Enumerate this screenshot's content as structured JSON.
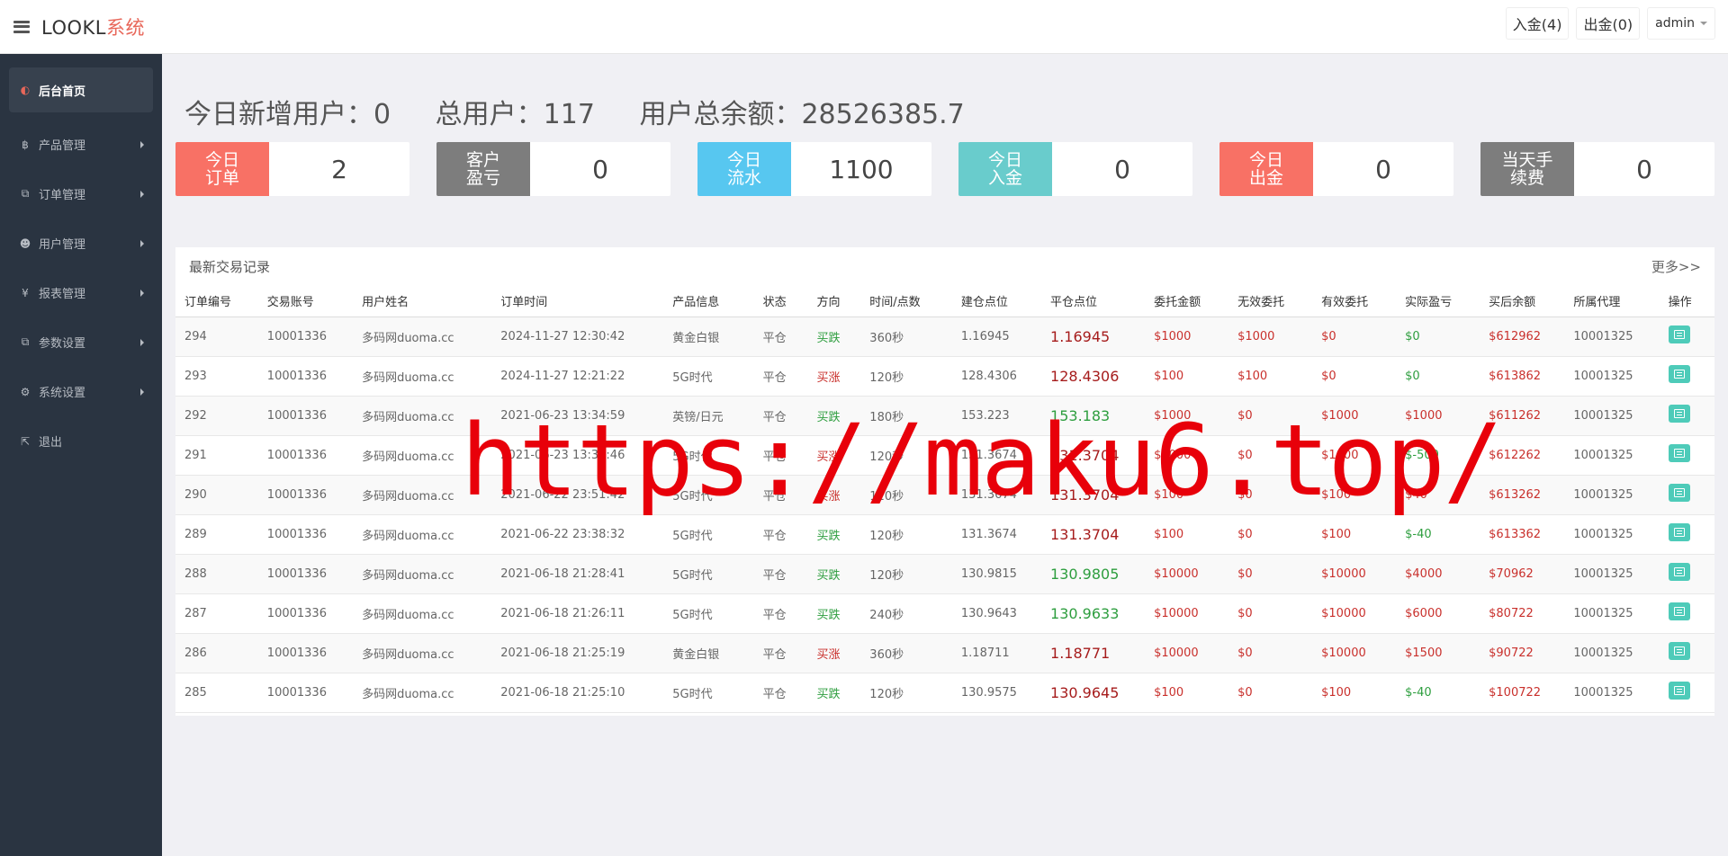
{
  "header": {
    "brand_main": "LOOKL",
    "brand_accent": "系统",
    "deposit_label": "入金(4)",
    "withdraw_label": "出金(0)",
    "admin_label": "admin"
  },
  "sidebar": {
    "items": [
      {
        "label": "后台首页",
        "icon": "dashboard-icon"
      },
      {
        "label": "产品管理",
        "icon": "bitcoin-icon"
      },
      {
        "label": "订单管理",
        "icon": "copy-icon"
      },
      {
        "label": "用户管理",
        "icon": "user-icon"
      },
      {
        "label": "报表管理",
        "icon": "yen-icon"
      },
      {
        "label": "参数设置",
        "icon": "copy-icon"
      },
      {
        "label": "系统设置",
        "icon": "gears-icon"
      },
      {
        "label": "退出",
        "icon": "sign-out-icon"
      }
    ]
  },
  "stats": {
    "new_users": "今日新增用户：0",
    "total_users": "总用户：117",
    "total_balance": "用户总余额：28526385.7"
  },
  "cards": [
    {
      "label": "今日订单",
      "value": "2",
      "color": "#f87165"
    },
    {
      "label": "客户盈亏",
      "value": "0",
      "color": "#7d7d7d"
    },
    {
      "label": "今日流水",
      "value": "1100",
      "color": "#57c7f0"
    },
    {
      "label": "今日入金",
      "value": "0",
      "color": "#69cccc"
    },
    {
      "label": "今日出金",
      "value": "0",
      "color": "#f87165"
    },
    {
      "label": "当天手续费",
      "value": "0",
      "color": "#7d7d7d"
    }
  ],
  "panel": {
    "title": "最新交易记录",
    "more": "更多>>"
  },
  "table": {
    "columns": [
      "订单编号",
      "交易账号",
      "用户姓名",
      "订单时间",
      "产品信息",
      "状态",
      "方向",
      "时间/点数",
      "建仓点位",
      "平仓点位",
      "委托金额",
      "无效委托",
      "有效委托",
      "实际盈亏",
      "买后余额",
      "所属代理",
      "操作"
    ],
    "rows": [
      [
        "294",
        "10001336",
        "多码网duoma.cc",
        "2024-11-27 12:30:42",
        "黄金白银",
        "平仓",
        "买跌",
        "360秒",
        "1.16945",
        "1.16945",
        "$1000",
        "$1000",
        "$0",
        "$0",
        "$612962",
        "10001325"
      ],
      [
        "293",
        "10001336",
        "多码网duoma.cc",
        "2024-11-27 12:21:22",
        "5G时代",
        "平仓",
        "买涨",
        "120秒",
        "128.4306",
        "128.4306",
        "$100",
        "$100",
        "$0",
        "$0",
        "$613862",
        "10001325"
      ],
      [
        "292",
        "10001336",
        "多码网duoma.cc",
        "2021-06-23 13:34:59",
        "英镑/日元",
        "平仓",
        "买跌",
        "180秒",
        "153.223",
        "153.183",
        "$1000",
        "$0",
        "$1000",
        "$1000",
        "$611262",
        "10001325"
      ],
      [
        "291",
        "10001336",
        "多码网duoma.cc",
        "2021-06-23 13:33:46",
        "5G时代",
        "平仓",
        "买涨",
        "120秒",
        "131.3674",
        "131.3704",
        "$1000",
        "$0",
        "$1000",
        "$-500",
        "$612262",
        "10001325"
      ],
      [
        "290",
        "10001336",
        "多码网duoma.cc",
        "2021-06-22 23:51:42",
        "5G时代",
        "平仓",
        "买涨",
        "120秒",
        "131.3674",
        "131.3704",
        "$100",
        "$0",
        "$100",
        "$40",
        "$613262",
        "10001325"
      ],
      [
        "289",
        "10001336",
        "多码网duoma.cc",
        "2021-06-22 23:38:32",
        "5G时代",
        "平仓",
        "买跌",
        "120秒",
        "131.3674",
        "131.3704",
        "$100",
        "$0",
        "$100",
        "$-40",
        "$613362",
        "10001325"
      ],
      [
        "288",
        "10001336",
        "多码网duoma.cc",
        "2021-06-18 21:28:41",
        "5G时代",
        "平仓",
        "买跌",
        "120秒",
        "130.9815",
        "130.9805",
        "$10000",
        "$0",
        "$10000",
        "$4000",
        "$70962",
        "10001325"
      ],
      [
        "287",
        "10001336",
        "多码网duoma.cc",
        "2021-06-18 21:26:11",
        "5G时代",
        "平仓",
        "买跌",
        "240秒",
        "130.9643",
        "130.9633",
        "$10000",
        "$0",
        "$10000",
        "$6000",
        "$80722",
        "10001325"
      ],
      [
        "286",
        "10001336",
        "多码网duoma.cc",
        "2021-06-18 21:25:19",
        "黄金白银",
        "平仓",
        "买涨",
        "360秒",
        "1.18711",
        "1.18771",
        "$10000",
        "$0",
        "$10000",
        "$1500",
        "$90722",
        "10001325"
      ],
      [
        "285",
        "10001336",
        "多码网duoma.cc",
        "2021-06-18 21:25:10",
        "5G时代",
        "平仓",
        "买跌",
        "120秒",
        "130.9575",
        "130.9645",
        "$100",
        "$0",
        "$100",
        "$-40",
        "$100722",
        "10001325"
      ]
    ],
    "close_price_colors": [
      "red",
      "red",
      "green",
      "red",
      "red",
      "red",
      "green",
      "green",
      "red",
      "red"
    ],
    "profit_colors": [
      "green",
      "green",
      "red",
      "green",
      "red",
      "green",
      "red",
      "red",
      "red",
      "green"
    ],
    "direction_colors": [
      "green",
      "red",
      "green",
      "red",
      "red",
      "green",
      "green",
      "green",
      "red",
      "green"
    ]
  },
  "watermark": "https://maku6.top/"
}
